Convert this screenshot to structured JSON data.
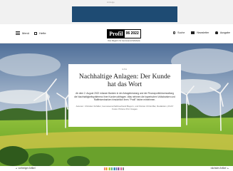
{
  "ad": {
    "label": "Anzeige"
  },
  "masthead": {
    "menu_label": "Menü",
    "issues_label": "Hefte",
    "logo_name": "Profil",
    "logo_issue": "06 2022",
    "logo_tagline": "Das Magazin für Genossenschaftsbank",
    "search_label": "Suche",
    "newsletter_label": "Newsletter",
    "account_label": "Ausgabe"
  },
  "article": {
    "kicker": "ESG",
    "headline": "Nachhaltige Anlagen: Der Kunde hat das Wort",
    "lead": "Ab dem 2. August 2022 müssen Banken in der Anlageberatung und der Finanzportfolioverwaltung die Nachhaltigkeitspräferenz ihrer Kunden abfragen. Was nehmen die bayerischen Volksbanken und Raiffeisenbanken hinsichtlich ihres \"Profil\" bisher mitnehmen.",
    "authors": "Autoren: Christian Schäfer, Genossenschaftsverband Bayern, und Florian Christ-Bar, Redaktion „Profil“\nFotos: Picture Pro/ Images"
  },
  "nav": {
    "prev_label": "vorheriger Artikel",
    "next_label": "nächster Artikel"
  },
  "progress_colors": [
    "#e94e3c",
    "#f28c28",
    "#f6c333",
    "#9acd32",
    "#2ca02c",
    "#1f9ea0",
    "#2c7fb8",
    "#3e4ea0",
    "#7b4fa0",
    "#b84a9b",
    "#d6266a",
    "#888888"
  ],
  "icons": {
    "menu": "burger-icon",
    "issues": "grid-icon",
    "search": "search-icon",
    "newsletter": "mail-icon",
    "account": "user-icon",
    "prev": "arrow-left-icon",
    "next": "arrow-right-icon"
  }
}
